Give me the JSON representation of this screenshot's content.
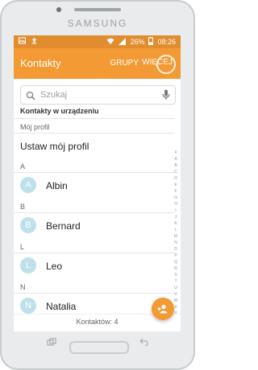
{
  "device": {
    "brand": "SAMSUNG"
  },
  "statusbar": {
    "battery": "26%",
    "time": "08:26"
  },
  "appbar": {
    "title": "Kontakty",
    "groups_label": "GRUPY",
    "more_label": "WIĘCEJ"
  },
  "search": {
    "placeholder": "Szukaj"
  },
  "list": {
    "contacts_header": "Kontakty w urządzeniu",
    "profile_header": "Mój profil",
    "profile_action": "Ustaw mój profil",
    "sections": [
      {
        "letter": "A",
        "avatar": "A",
        "name": "Albin"
      },
      {
        "letter": "B",
        "avatar": "B",
        "name": "Bernard"
      },
      {
        "letter": "L",
        "avatar": "L",
        "name": "Leo"
      },
      {
        "letter": "N",
        "avatar": "N",
        "name": "Natalia"
      }
    ]
  },
  "footer": {
    "count_label": "Kontaktów: 4"
  },
  "colors": {
    "accent": "#f39a34",
    "statusbar": "#e18d2f",
    "avatar_bg": "#bfe0ea"
  },
  "icons": {
    "search": "search-icon",
    "mic": "mic-icon",
    "add_contact": "add-contact-icon",
    "wifi": "wifi-icon",
    "battery": "battery-icon",
    "upload": "upload-icon",
    "image": "image-icon"
  },
  "index_letters": [
    "#",
    "A",
    "B",
    "C",
    "D",
    "E",
    "F",
    "G",
    "H",
    "I",
    "J",
    "K",
    "L",
    "M",
    "N",
    "O",
    "P",
    "Q",
    "R",
    "S",
    "T",
    "U",
    "V",
    "W",
    "X",
    "Y",
    "Z"
  ]
}
